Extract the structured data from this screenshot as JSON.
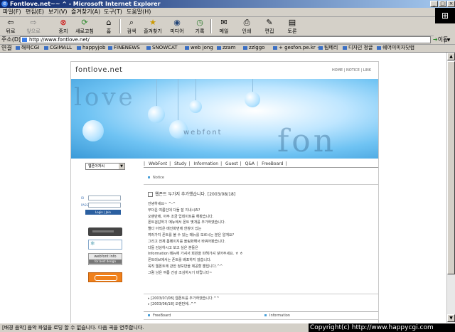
{
  "window": {
    "title": "Fontlove.net~~ ^ - Microsoft Internet Explorer"
  },
  "menu": [
    "파일(F)",
    "편집(E)",
    "보기(V)",
    "즐겨찾기(A)",
    "도구(T)",
    "도움말(H)"
  ],
  "toolbar": {
    "back": "뒤로",
    "forward": "앞으로",
    "stop": "중지",
    "refresh": "새로고침",
    "home": "홈",
    "search": "검색",
    "favorites": "즐겨찾기",
    "media": "미디어",
    "history": "기록",
    "mail": "메일",
    "print": "인쇄",
    "edit": "편집",
    "discuss": "토론"
  },
  "address": {
    "label": "주소(D)",
    "url": "http://www.fontlove.net/",
    "go": "이동"
  },
  "links": {
    "label": "연결",
    "items": [
      "해피CGI",
      "CGIMALL",
      "happyjob",
      "FINENEWS",
      "SNOWCAT",
      "web jong",
      "zzam",
      "zzlggo",
      "+ gesfon.pe.kr +",
      "팀메리",
      "디자인 정글",
      "쉐어미미자닷컴"
    ]
  },
  "site": {
    "logo": "fontlove.net",
    "toplinks": "HOME | NOTICE | LINK",
    "banner_text_1": "love",
    "banner_text_2": "fon",
    "banner_webfont": "webfont",
    "nav": [
      "WebFont",
      "Study",
      "Information",
      "Guest",
      "Q&A",
      "FreeBoard"
    ],
    "select_value": "웹폰아저씨",
    "notice_label": "Notice",
    "login": {
      "id_label": "ID",
      "pass_label": "PASS",
      "button": "Login | Join"
    },
    "badge": {
      "title": "webfont info",
      "sub": "for best design"
    },
    "post_title": "웹폰트 두가지 추가했습니다. [2003/08/18]",
    "post_lines": [
      "안녕하세요~ ^-^",
      "무더운 여름인데 다들 잘 지내시죠?",
      "오랜만에, 아주 조금 업데이트를 해봤습니다.",
      "폰트검감하기 메뉴에서 폰트 몇개를 추가하였습니다.",
      "별다 아직은 메인화면에 한창이 있는",
      "여러가지 폰트를 볼 수 있는 메뉴를 모르시는 분은 알게요?",
      "그리고 전체 폼페이지를 올림화해서 바꿔어봤습니다.",
      "다들 감상하시고 보고 싶은 분들은",
      "Information 메뉴에 가셔서 회원을 파헤가셔 넣어주세요. ㅎ ㅎ",
      "폰트러브에서는 폰트를 배포하지 않습니다.",
      "육직 웹폰트에 관한 정보만을 제공할 뿐입니다.^^",
      "그럼 남은 여름 건강 조심하시기 바랍니다~"
    ],
    "list_items": [
      "[2003/07/08] 웹폰트를 추가하였습니다.^^",
      "[2003/06/18] 오랜만에..^^"
    ],
    "freeboard": "FreeBoard",
    "information": "Information"
  },
  "status": {
    "text": "[배경 음악] 음악 파일을 로딩 할 수 없습니다. 다음 곡을 연주합니다.",
    "copyright": "Copyright(c) http://www.happycgi.com"
  }
}
